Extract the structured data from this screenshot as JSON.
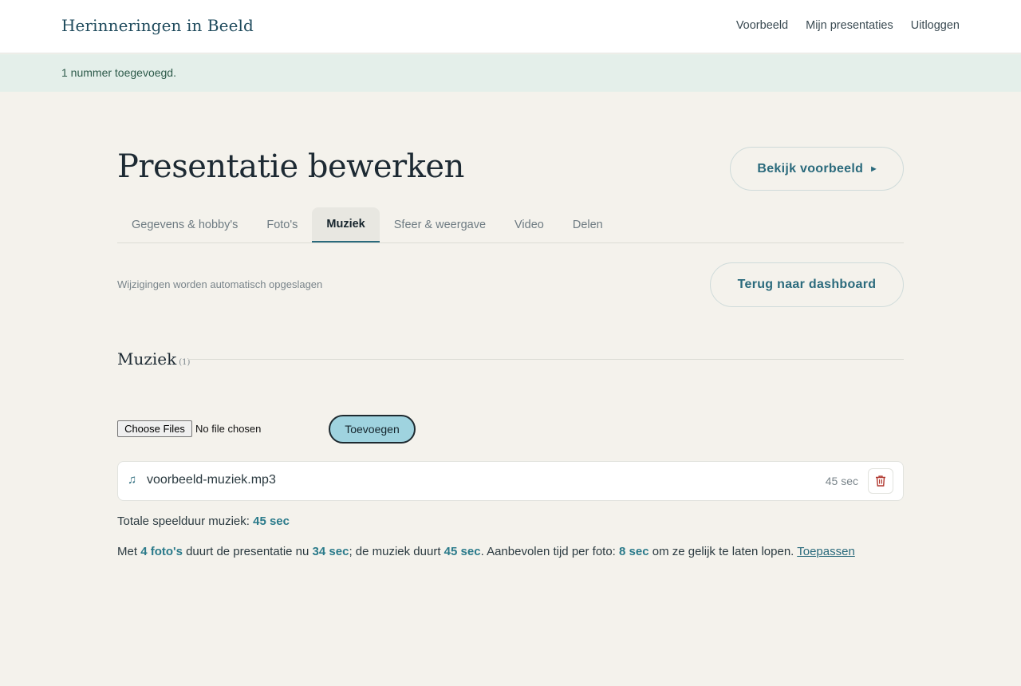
{
  "header": {
    "brand": "Herinneringen in Beeld",
    "nav": [
      "Voorbeeld",
      "Mijn presentaties",
      "Uitloggen"
    ]
  },
  "flash": "1 nummer toegevoegd.",
  "page": {
    "title": "Presentatie bewerken",
    "preview_button": "Bekijk voorbeeld",
    "preview_icon": "play-triangle",
    "dashboard_button": "Terug naar dashboard",
    "autosave_note": "Wijzigingen worden automatisch opgeslagen"
  },
  "tabs": [
    {
      "label": "Gegevens & hobby's",
      "active": false
    },
    {
      "label": "Foto's",
      "active": false
    },
    {
      "label": "Muziek",
      "active": true
    },
    {
      "label": "Sfeer & weergave",
      "active": false
    },
    {
      "label": "Video",
      "active": false
    },
    {
      "label": "Delen",
      "active": false
    }
  ],
  "section": {
    "title": "Muziek",
    "count": "(1)"
  },
  "upload": {
    "choose_label": "Choose Files",
    "status": "No file chosen",
    "add_button": "Toevoegen"
  },
  "tracks": [
    {
      "icon": "music-note-icon",
      "name": "voorbeeld-muziek.mp3",
      "duration": "45 sec"
    }
  ],
  "total": {
    "label": "Totale speelduur muziek:",
    "value": "45 sec"
  },
  "summary": {
    "p1": "Met ",
    "photos": "4 foto's",
    "p2": " duurt de presentatie nu ",
    "presentation": "34 sec",
    "p3": "; de muziek duurt ",
    "music": "45 sec",
    "p4": ". Aanbevolen tijd per foto: ",
    "per_photo": "8 sec",
    "p5": " om ze gelijk te laten lopen. ",
    "apply_link": "Toepassen"
  },
  "colors": {
    "accent": "#2a6a7c",
    "highlight": "#2a7a8a",
    "background": "#f4f2ec",
    "flash_bg": "#e4efea",
    "add_button_bg": "#9fd3df",
    "delete_icon": "#b0372f"
  }
}
